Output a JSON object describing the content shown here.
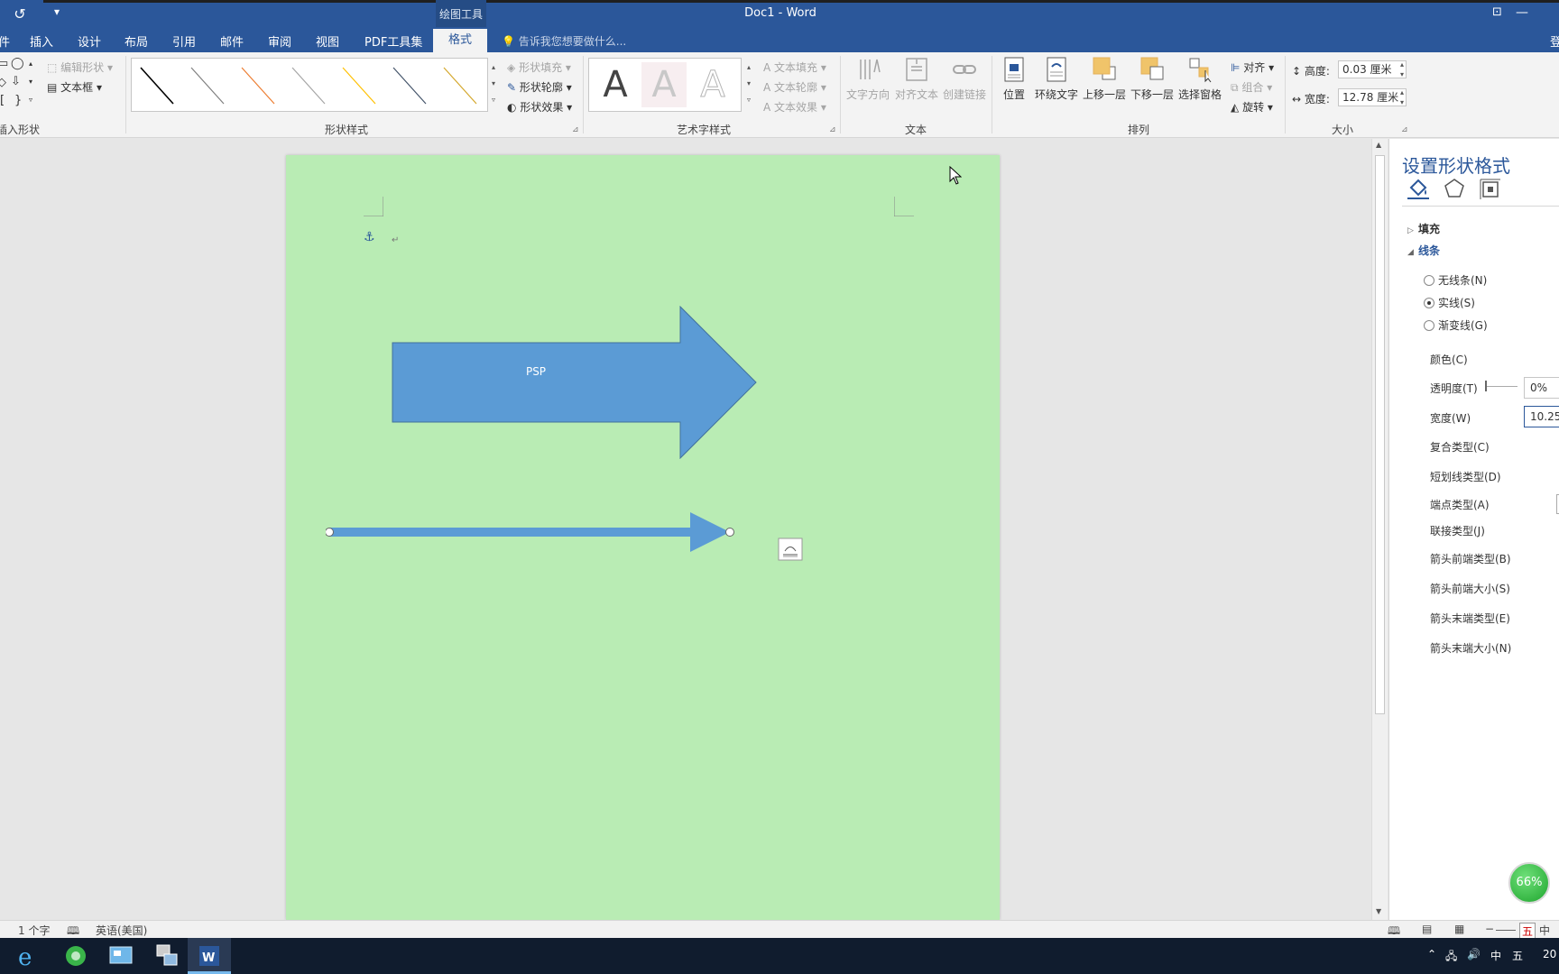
{
  "titlebar": {
    "context_tools": "绘图工具",
    "doc_title": "Doc1 - Word"
  },
  "tabs": {
    "items": [
      "插入",
      "设计",
      "布局",
      "引用",
      "邮件",
      "审阅",
      "视图",
      "PDF工具集"
    ],
    "active": "格式",
    "tell_me": "告诉我您想要做什么...",
    "sign_in": "登"
  },
  "ribbon": {
    "insert_shapes": {
      "edit_shape": "编辑形状",
      "textbox": "文本框",
      "label": "插入形状"
    },
    "shape_styles": {
      "fill": "形状填充",
      "outline": "形状轮廓",
      "effects": "形状效果",
      "label": "形状样式",
      "swatch_colors": [
        "#000000",
        "#7f7f7f",
        "#ed7d31",
        "#a5a5a5",
        "#ffc000",
        "#44546a",
        "#d4a72c"
      ]
    },
    "wordart": {
      "glyph": "A",
      "text_fill": "文本填充",
      "text_outline": "文本轮廓",
      "text_effects": "文本效果",
      "label": "艺术字样式"
    },
    "text": {
      "direction": "文字方向",
      "align": "对齐文本",
      "link": "创建链接",
      "label": "文本"
    },
    "arrange": {
      "position": "位置",
      "wrap": "环绕文字",
      "forward": "上移一层",
      "backward": "下移一层",
      "selection_pane": "选择窗格",
      "align": "对齐",
      "group": "组合",
      "rotate": "旋转",
      "label": "排列"
    },
    "size": {
      "height_label": "高度:",
      "height_value": "0.03 厘米",
      "width_label": "宽度:",
      "width_value": "12.78 厘米",
      "label": "大小"
    }
  },
  "document": {
    "page_color": "#b9ecb4",
    "arrow_label": "PSP",
    "arrow_color": "#5b9bd5"
  },
  "pane": {
    "title": "设置形状格式",
    "sections": {
      "fill": "填充",
      "line": "线条"
    },
    "radios": [
      "无线条(N)",
      "实线(S)",
      "渐变线(G)"
    ],
    "selected_radio": 1,
    "props": {
      "color": "颜色(C)",
      "transparency": "透明度(T)",
      "transparency_value": "0%",
      "width": "宽度(W)",
      "width_value": "10.25",
      "compound": "复合类型(C)",
      "dash": "短划线类型(D)",
      "cap": "端点类型(A)",
      "join": "联接类型(J)",
      "begin_type": "箭头前端类型(B)",
      "begin_size": "箭头前端大小(S)",
      "end_type": "箭头末端类型(E)",
      "end_size": "箭头末端大小(N)"
    }
  },
  "status": {
    "word_count": "1 个字",
    "language": "英语(美国)",
    "zoom_minus": "−"
  },
  "perf_badge": "66%",
  "taskbar": {
    "ime_1": "中",
    "ime_2": "五",
    "clock": "20"
  }
}
